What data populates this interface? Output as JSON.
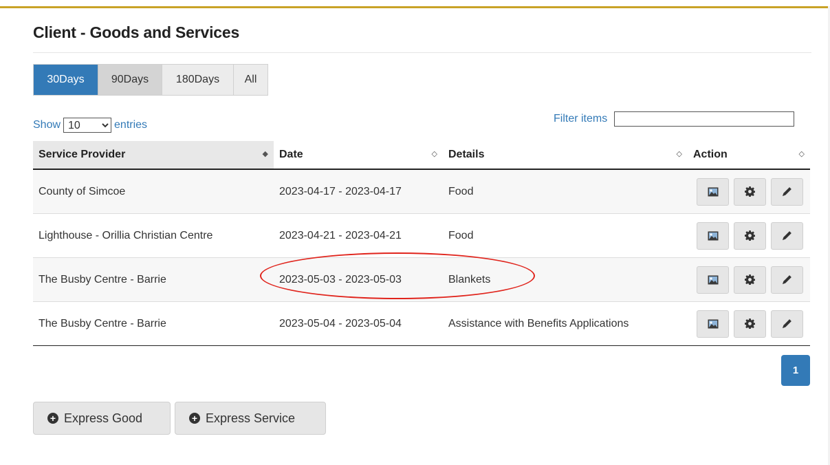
{
  "page": {
    "title": "Client - Goods and Services"
  },
  "tabs": [
    {
      "label": "30Days",
      "active": true
    },
    {
      "label": "90Days"
    },
    {
      "label": "180Days"
    },
    {
      "label": "All"
    }
  ],
  "length_control": {
    "prefix": "Show",
    "value": "10",
    "suffix": "entries"
  },
  "filter": {
    "label": "Filter items",
    "value": ""
  },
  "table": {
    "columns": [
      "Service Provider",
      "Date",
      "Details",
      "Action"
    ],
    "rows": [
      {
        "provider": "County of Simcoe",
        "date": "2023-04-17 - 2023-04-17",
        "details": "Food"
      },
      {
        "provider": "Lighthouse - Orillia Christian Centre",
        "date": "2023-04-21 - 2023-04-21",
        "details": "Food"
      },
      {
        "provider": "The Busby Centre - Barrie",
        "date": "2023-05-03 - 2023-05-03",
        "details": "Blankets"
      },
      {
        "provider": "The Busby Centre - Barrie",
        "date": "2023-05-04 - 2023-05-04",
        "details": "Assistance with Benefits Applications"
      }
    ],
    "row_actions": [
      "image-icon",
      "gear-icon",
      "pencil-icon"
    ],
    "sort_icon": "sort-diamond-icon"
  },
  "pagination": {
    "current": "1"
  },
  "buttons": {
    "express_good": "Express Good",
    "express_service": "Express Service"
  },
  "colors": {
    "primary": "#337ab7",
    "accent_rule": "#c9a227",
    "annotation": "#e0241c"
  }
}
